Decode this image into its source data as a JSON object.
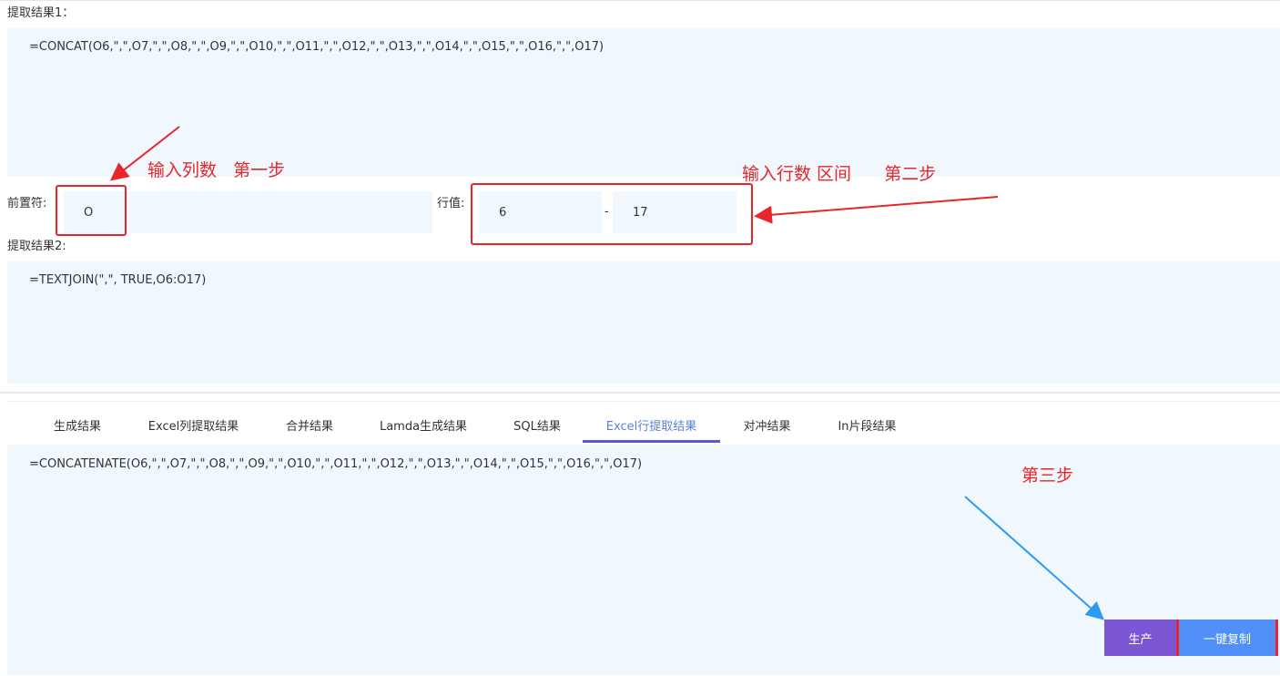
{
  "section1": {
    "title": "提取结果1：",
    "result": "=CONCAT(O6,\",\",O7,\",\",O8,\",\",O9,\",\",O10,\",\",O11,\",\",O12,\",\",O13,\",\",O14,\",\",O15,\",\",O16,\",\",O17)"
  },
  "form": {
    "prefix_label": "前置符:",
    "prefix_value": "O",
    "row_label": "行值:",
    "row_start": "6",
    "row_separator": "-",
    "row_end": "17"
  },
  "section2": {
    "title": "提取结果2:",
    "result": "=TEXTJOIN(\",\", TRUE,O6:O17)"
  },
  "tabs": [
    {
      "label": "生成结果"
    },
    {
      "label": "Excel列提取结果"
    },
    {
      "label": "合并结果"
    },
    {
      "label": "Lamda生成结果"
    },
    {
      "label": "SQL结果"
    },
    {
      "label": "Excel行提取结果",
      "active": true
    },
    {
      "label": "对冲结果"
    },
    {
      "label": "In片段结果"
    }
  ],
  "tab_result": "=CONCATENATE(O6,\",\",O7,\",\",O8,\",\",O9,\",\",O10,\",\",O11,\",\",O12,\",\",O13,\",\",O14,\",\",O15,\",\",O16,\",\",O17)",
  "buttons": {
    "generate": "生产",
    "copy": "一键复制"
  },
  "annotations": {
    "step1": "输入列数   第一步",
    "step2": "输入行数 区间      第二步",
    "step3": "第三步"
  },
  "colors": {
    "annotation_red": "#e8262a",
    "arrow_blue": "#2d9bf0",
    "input_bg": "#f0f7fd",
    "tab_active": "#5b7fd8",
    "generate_button": "#7b57d6",
    "copy_button": "#4f8ff7"
  }
}
